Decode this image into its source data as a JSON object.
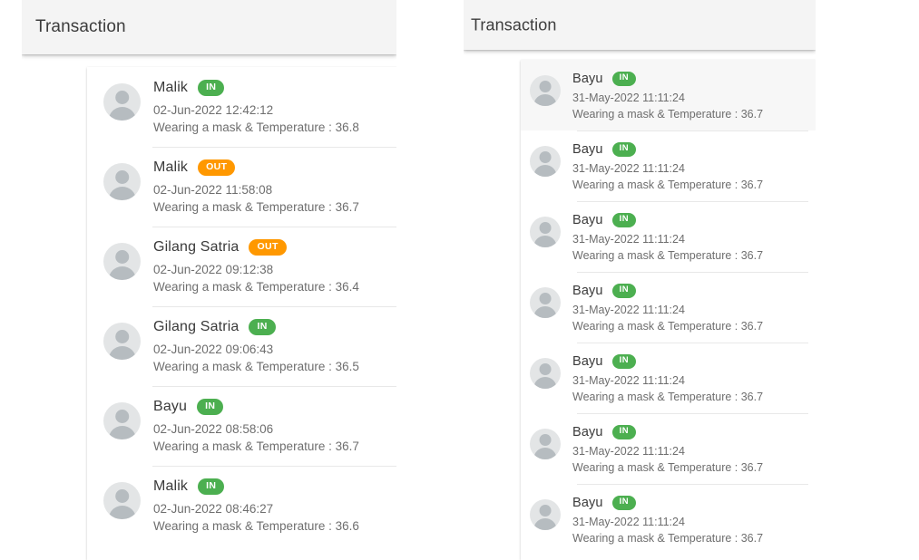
{
  "colors": {
    "badge_in": "#4caf50",
    "badge_out": "#ff9800",
    "header_bg": "#f4f4f4",
    "card_bg": "#ffffff",
    "active_row_bg": "#f7f7f7",
    "divider": "#e8e8e8",
    "name_text": "#3a3a3a",
    "sub_text": "#6e6e6e"
  },
  "left_panel": {
    "title": "Transaction",
    "rows": [
      {
        "name": "Malik",
        "status": "IN",
        "timestamp": "02-Jun-2022 12:42:12",
        "detail": "Wearing a mask & Temperature : 36.8",
        "temperature": "36.8",
        "active": false
      },
      {
        "name": "Malik",
        "status": "OUT",
        "timestamp": "02-Jun-2022 11:58:08",
        "detail": "Wearing a mask & Temperature : 36.7",
        "temperature": "36.7",
        "active": false
      },
      {
        "name": "Gilang Satria",
        "status": "OUT",
        "timestamp": "02-Jun-2022 09:12:38",
        "detail": "Wearing a mask & Temperature : 36.4",
        "temperature": "36.4",
        "active": false
      },
      {
        "name": "Gilang Satria",
        "status": "IN",
        "timestamp": "02-Jun-2022 09:06:43",
        "detail": "Wearing a mask & Temperature : 36.5",
        "temperature": "36.5",
        "active": false
      },
      {
        "name": "Bayu",
        "status": "IN",
        "timestamp": "02-Jun-2022 08:58:06",
        "detail": "Wearing a mask & Temperature : 36.7",
        "temperature": "36.7",
        "active": false
      },
      {
        "name": "Malik",
        "status": "IN",
        "timestamp": "02-Jun-2022 08:46:27",
        "detail": "Wearing a mask & Temperature : 36.6",
        "temperature": "36.6",
        "active": false
      }
    ]
  },
  "right_panel": {
    "title": "Transaction",
    "rows": [
      {
        "name": "Bayu",
        "status": "IN",
        "timestamp": "31-May-2022 11:11:24",
        "detail": "Wearing a mask & Temperature : 36.7",
        "temperature": "36.7",
        "active": true
      },
      {
        "name": "Bayu",
        "status": "IN",
        "timestamp": "31-May-2022 11:11:24",
        "detail": "Wearing a mask & Temperature : 36.7",
        "temperature": "36.7",
        "active": false
      },
      {
        "name": "Bayu",
        "status": "IN",
        "timestamp": "31-May-2022 11:11:24",
        "detail": "Wearing a mask & Temperature : 36.7",
        "temperature": "36.7",
        "active": false
      },
      {
        "name": "Bayu",
        "status": "IN",
        "timestamp": "31-May-2022 11:11:24",
        "detail": "Wearing a mask & Temperature : 36.7",
        "temperature": "36.7",
        "active": false
      },
      {
        "name": "Bayu",
        "status": "IN",
        "timestamp": "31-May-2022 11:11:24",
        "detail": "Wearing a mask & Temperature : 36.7",
        "temperature": "36.7",
        "active": false
      },
      {
        "name": "Bayu",
        "status": "IN",
        "timestamp": "31-May-2022 11:11:24",
        "detail": "Wearing a mask & Temperature : 36.7",
        "temperature": "36.7",
        "active": false
      },
      {
        "name": "Bayu",
        "status": "IN",
        "timestamp": "31-May-2022 11:11:24",
        "detail": "Wearing a mask & Temperature : 36.7",
        "temperature": "36.7",
        "active": false
      }
    ]
  }
}
